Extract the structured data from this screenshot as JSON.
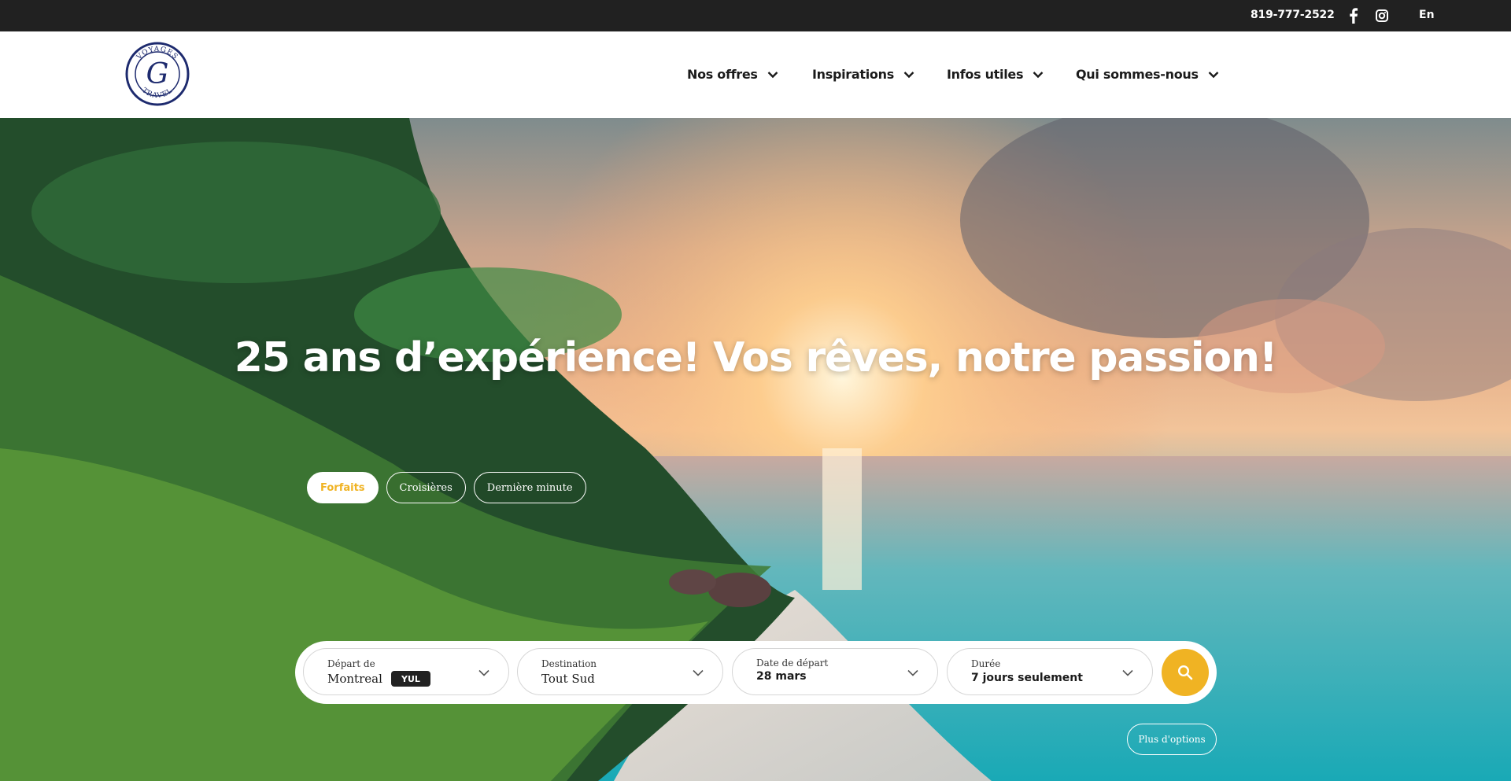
{
  "topbar": {
    "phone": "819-777-2522",
    "social": [
      {
        "icon": "facebook-icon"
      },
      {
        "icon": "instagram-icon"
      }
    ],
    "language": "En"
  },
  "header": {
    "logo_text": [
      "VOYAGES",
      "G",
      "TRAVEL"
    ],
    "nav": [
      {
        "label": "Nos offres"
      },
      {
        "label": "Inspirations"
      },
      {
        "label": "Infos utiles"
      },
      {
        "label": "Qui sommes-nous"
      }
    ]
  },
  "hero": {
    "title": "25 ans d’expérience! Vos rêves, notre passion!"
  },
  "search": {
    "tabs": [
      {
        "label": "Forfaits",
        "active": true
      },
      {
        "label": "Croisières",
        "active": false
      },
      {
        "label": "Dernière minute",
        "active": false
      }
    ],
    "fields": {
      "departure": {
        "label": "Départ de",
        "value": "Montreal",
        "code": "YUL"
      },
      "destination": {
        "label": "Destination",
        "value": "Tout Sud"
      },
      "date": {
        "label": "Date de départ",
        "value": "28 mars"
      },
      "duration": {
        "label": "Durée",
        "value": "7 jours seulement"
      }
    },
    "more_options": "Plus d'options"
  },
  "colors": {
    "accent": "#f0b323",
    "topbar": "#212121",
    "logo": "#1d2a6e"
  }
}
